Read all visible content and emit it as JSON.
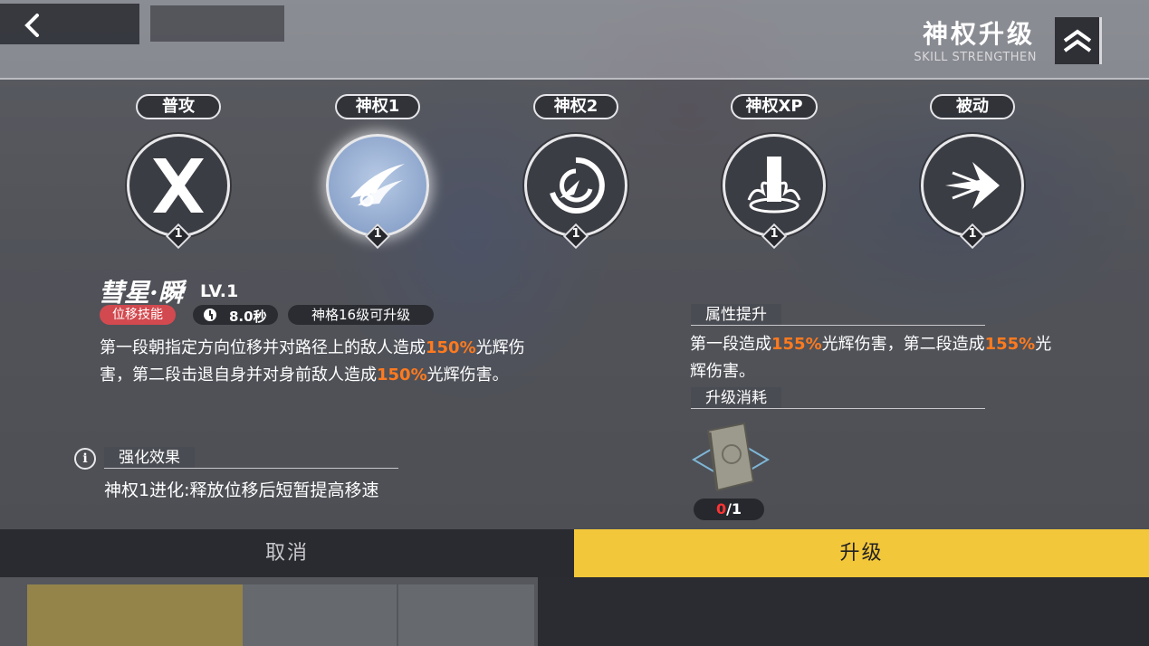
{
  "header": {
    "title": "神权升级",
    "subtitle": "SKILL STRENGTHEN"
  },
  "skills": [
    {
      "label": "普攻",
      "level": "1",
      "icon": "crossed-blades-icon",
      "active": false
    },
    {
      "label": "神权1",
      "level": "1",
      "icon": "comet-dash-icon",
      "active": true
    },
    {
      "label": "神权2",
      "level": "1",
      "icon": "swirl-slash-icon",
      "active": false
    },
    {
      "label": "神权XP",
      "level": "1",
      "icon": "light-pillar-icon",
      "active": false
    },
    {
      "label": "被动",
      "level": "1",
      "icon": "burst-arrow-icon",
      "active": false
    }
  ],
  "detail": {
    "name": "彗星·瞬",
    "level": "LV.1",
    "type_tag": "位移技能",
    "cooldown": "8.0秒",
    "upgrade_req": "神格16级可升级",
    "desc_parts": [
      "第一段朝指定方向位移并对路径上的敌人造成",
      "150%",
      "光辉伤\n害，第二段击退自身并对身前敌人造成",
      "150%",
      "光辉伤害。"
    ]
  },
  "enhance": {
    "title": "强化效果",
    "text": "神权1进化:释放位移后短暂提高移速"
  },
  "attribute": {
    "title": "属性提升",
    "parts": [
      "第一段造成",
      "155%",
      "光辉伤害，第二段造成",
      "155%",
      "光\n辉伤害。"
    ]
  },
  "cost": {
    "title": "升级消耗",
    "item_icon": "skill-book-icon",
    "have": "0",
    "need": "/1"
  },
  "buttons": {
    "cancel": "取消",
    "upgrade": "升级"
  },
  "colors": {
    "highlight": "#ff7a1e",
    "upgrade_button": "#f3c73a",
    "type_tag": "#d24a4f"
  }
}
